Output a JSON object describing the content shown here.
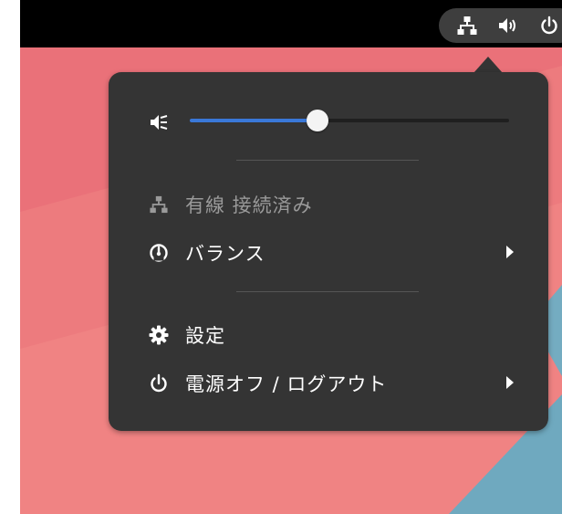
{
  "topbar": {
    "tray_icons": [
      "network-wired-icon",
      "volume-icon",
      "power-icon"
    ]
  },
  "volume": {
    "icon": "volume-muted-icon",
    "level_percent": 40,
    "accent_color": "#3a78d8"
  },
  "menu": {
    "network_label": "有線 接続済み",
    "power_mode_label": "バランス",
    "settings_label": "設定",
    "power_off_label": "電源オフ / ログアウト"
  },
  "colors": {
    "menu_bg": "#343434",
    "desktop_pink": "#ea7179",
    "desktop_blue": "#6fa9bf"
  }
}
